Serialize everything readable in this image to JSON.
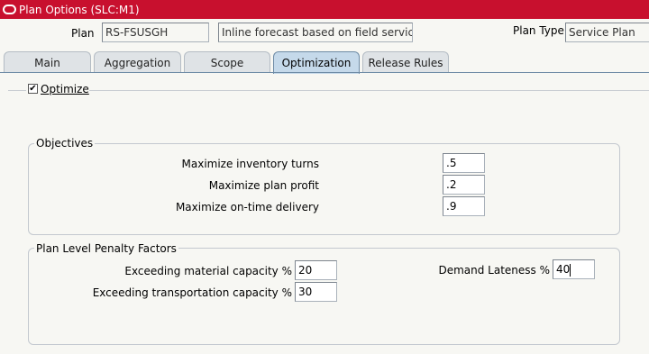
{
  "window": {
    "title": "Plan Options (SLC:M1)"
  },
  "header": {
    "plan_label": "Plan",
    "plan_value": "RS-FSUSGH",
    "description": "Inline forecast based on field service",
    "plan_type_label": "Plan Type",
    "plan_type_value": "Service Plan"
  },
  "tabs": [
    "Main",
    "Aggregation",
    "Scope",
    "Optimization",
    "Release Rules"
  ],
  "active_tab": "Optimization",
  "optimize": {
    "label": "Optimize",
    "checked": true,
    "check_glyph": "✔"
  },
  "objectives": {
    "title": "Objectives",
    "rows": [
      {
        "label": "Maximize inventory turns",
        "value": ".5"
      },
      {
        "label": "Maximize plan profit",
        "value": ".2"
      },
      {
        "label": "Maximize on-time delivery",
        "value": ".9"
      }
    ]
  },
  "penalty": {
    "title": "Plan Level Penalty Factors",
    "material_label": "Exceeding material capacity %",
    "material_value": "20",
    "transport_label": "Exceeding transportation capacity %",
    "transport_value": "30",
    "lateness_label": "Demand Lateness %",
    "lateness_value": "40"
  }
}
